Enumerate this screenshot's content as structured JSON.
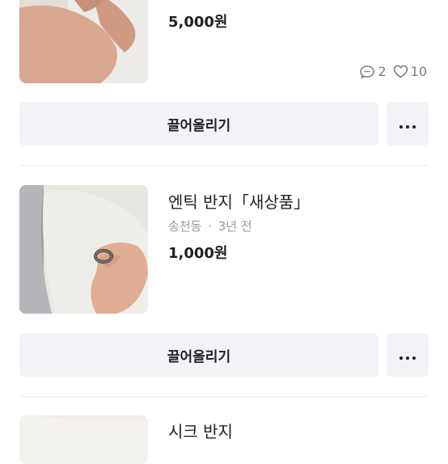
{
  "items": [
    {
      "price": "5,000원",
      "chat_count": "2",
      "like_count": "10",
      "bump_label": "끌어올리기"
    },
    {
      "title": "엔틱 반지「새상품」",
      "location": "송천동",
      "separator": "·",
      "time": "3년 전",
      "price": "1,000원",
      "bump_label": "끌어올리기"
    },
    {
      "title": "시크 반지"
    }
  ],
  "icons": {
    "chat": "chat-bubble-icon",
    "like": "heart-icon",
    "more": "more-dots-icon"
  }
}
